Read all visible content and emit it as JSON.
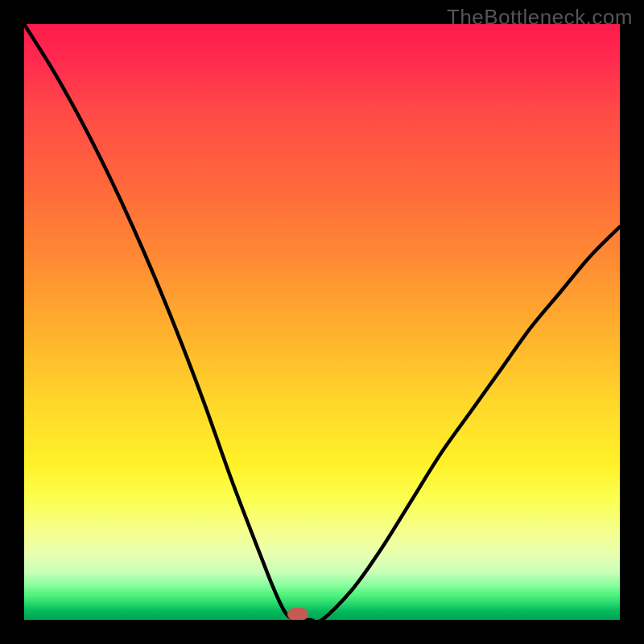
{
  "watermark": "TheBottleneck.com",
  "colors": {
    "background": "#000000",
    "curve": "#000000",
    "marker": "#c45a52"
  },
  "chart_data": {
    "type": "line",
    "title": "",
    "xlabel": "",
    "ylabel": "",
    "xlim": [
      0,
      100
    ],
    "ylim": [
      0,
      100
    ],
    "grid": false,
    "series": [
      {
        "name": "bottleneck-curve",
        "x": [
          0,
          5,
          10,
          15,
          20,
          25,
          30,
          35,
          40,
          42,
          44,
          46,
          48,
          50,
          55,
          60,
          65,
          70,
          75,
          80,
          85,
          90,
          95,
          100
        ],
        "values": [
          100,
          92,
          83,
          73,
          62,
          50,
          37,
          23,
          10,
          5,
          1,
          0,
          0,
          0,
          5,
          12,
          20,
          28,
          35,
          42,
          49,
          55,
          61,
          66
        ]
      }
    ],
    "annotations": [
      {
        "name": "optimum-marker",
        "x": 46,
        "y": 1
      }
    ],
    "background_gradient": {
      "direction": "vertical",
      "stops": [
        {
          "pos": 0.0,
          "color": "#ff1a4b"
        },
        {
          "pos": 0.4,
          "color": "#ff8c33"
        },
        {
          "pos": 0.74,
          "color": "#fff229"
        },
        {
          "pos": 0.96,
          "color": "#4bf07a"
        },
        {
          "pos": 1.0,
          "color": "#00a553"
        }
      ]
    }
  }
}
